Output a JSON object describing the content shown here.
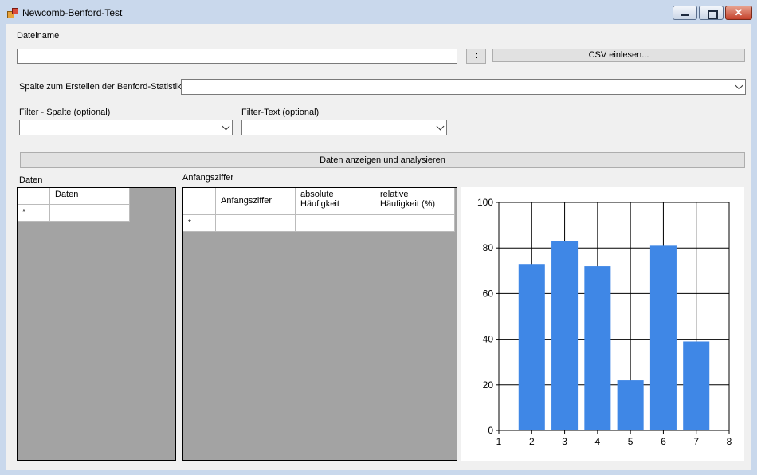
{
  "window": {
    "title": "Newcomb-Benford-Test"
  },
  "titlebar_buttons": {
    "close_glyph": "✕"
  },
  "file_section": {
    "label": "Dateiname",
    "filename_value": "",
    "browse_label": ":",
    "read_csv_label": "CSV einlesen..."
  },
  "column_section": {
    "label": "Spalte zum Erstellen der Benford-Statistik",
    "selected": ""
  },
  "filter_section": {
    "column_label": "Filter - Spalte (optional)",
    "column_selected": "",
    "text_label": "Filter-Text (optional)",
    "text_selected": ""
  },
  "analyze_button": "Daten anzeigen und analysieren",
  "data_grid": {
    "caption": "Daten",
    "columns": [
      "Daten"
    ],
    "new_row_marker": "*"
  },
  "digit_grid": {
    "caption": "Anfangsziffer",
    "columns": [
      {
        "line1": "Anfangsziffer",
        "line2": ""
      },
      {
        "line1": "absolute",
        "line2": "Häufigkeit"
      },
      {
        "line1": "relative",
        "line2": "Häufigkeit (%)"
      }
    ],
    "new_row_marker": "*"
  },
  "chart_data": {
    "type": "bar",
    "x": [
      2,
      3,
      4,
      5,
      6,
      7
    ],
    "values": [
      73,
      83,
      72,
      22,
      81,
      39
    ],
    "xlim": [
      1,
      8
    ],
    "ylim": [
      0,
      100
    ],
    "xticks": [
      1,
      2,
      3,
      4,
      5,
      6,
      7,
      8
    ],
    "yticks": [
      0,
      20,
      40,
      60,
      80,
      100
    ],
    "grid": true,
    "bar_color": "#3f87e6",
    "title": "",
    "xlabel": "",
    "ylabel": ""
  }
}
